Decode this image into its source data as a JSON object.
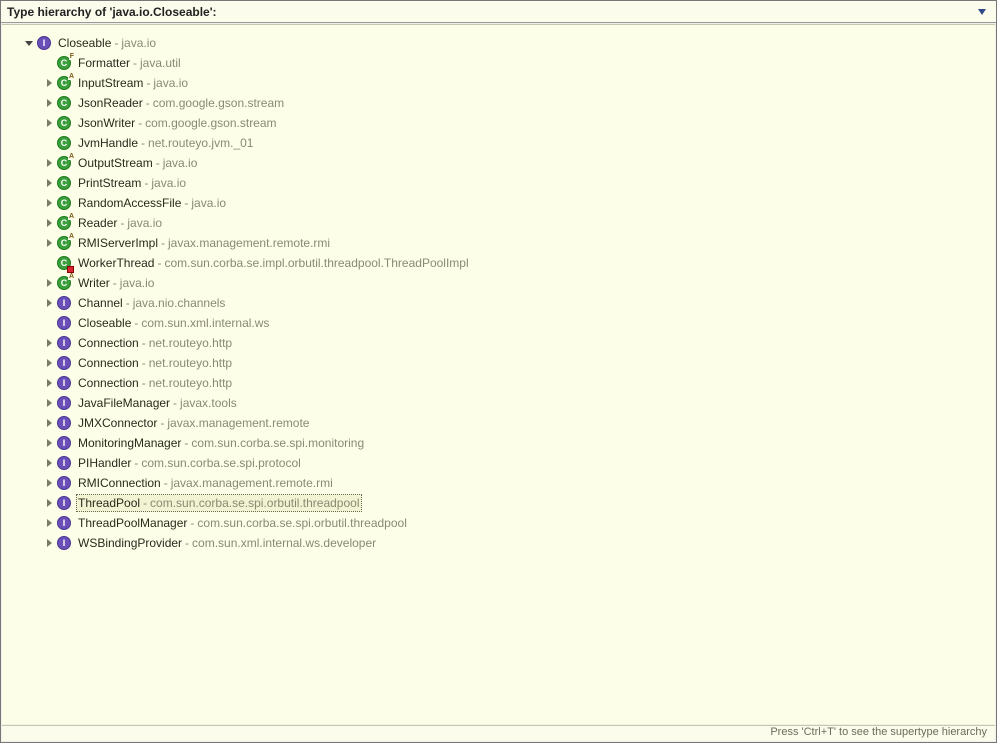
{
  "header": {
    "title": "Type hierarchy of 'java.io.Closeable':"
  },
  "footer": {
    "hint": "Press 'Ctrl+T' to see the supertype hierarchy"
  },
  "icon_letter": {
    "interface": "I",
    "class": "C"
  },
  "tree": {
    "root": {
      "name": "Closeable",
      "pkg": "java.io",
      "kind": "interface",
      "expanded": true,
      "children": [
        {
          "name": "Formatter",
          "pkg": "java.util",
          "kind": "class",
          "badge": "F",
          "hasChildren": false
        },
        {
          "name": "InputStream",
          "pkg": "java.io",
          "kind": "class",
          "badge": "A",
          "hasChildren": true
        },
        {
          "name": "JsonReader",
          "pkg": "com.google.gson.stream",
          "kind": "class",
          "hasChildren": true
        },
        {
          "name": "JsonWriter",
          "pkg": "com.google.gson.stream",
          "kind": "class",
          "hasChildren": true
        },
        {
          "name": "JvmHandle",
          "pkg": "net.routeyo.jvm._01",
          "kind": "class",
          "hasChildren": false
        },
        {
          "name": "OutputStream",
          "pkg": "java.io",
          "kind": "class",
          "badge": "A",
          "hasChildren": true
        },
        {
          "name": "PrintStream",
          "pkg": "java.io",
          "kind": "class",
          "hasChildren": true
        },
        {
          "name": "RandomAccessFile",
          "pkg": "java.io",
          "kind": "class",
          "hasChildren": true
        },
        {
          "name": "Reader",
          "pkg": "java.io",
          "kind": "class",
          "badge": "A",
          "hasChildren": true
        },
        {
          "name": "RMIServerImpl",
          "pkg": "javax.management.remote.rmi",
          "kind": "class",
          "badge": "A",
          "hasChildren": true
        },
        {
          "name": "WorkerThread",
          "pkg": "com.sun.corba.se.impl.orbutil.threadpool.ThreadPoolImpl",
          "kind": "class",
          "error": true,
          "hasChildren": false
        },
        {
          "name": "Writer",
          "pkg": "java.io",
          "kind": "class",
          "badge": "A",
          "hasChildren": true
        },
        {
          "name": "Channel",
          "pkg": "java.nio.channels",
          "kind": "interface",
          "hasChildren": true
        },
        {
          "name": "Closeable",
          "pkg": "com.sun.xml.internal.ws",
          "kind": "interface",
          "hasChildren": false
        },
        {
          "name": "Connection",
          "pkg": "net.routeyo.http",
          "kind": "interface",
          "hasChildren": true
        },
        {
          "name": "Connection",
          "pkg": "net.routeyo.http",
          "kind": "interface",
          "hasChildren": true
        },
        {
          "name": "Connection",
          "pkg": "net.routeyo.http",
          "kind": "interface",
          "hasChildren": true
        },
        {
          "name": "JavaFileManager",
          "pkg": "javax.tools",
          "kind": "interface",
          "hasChildren": true
        },
        {
          "name": "JMXConnector",
          "pkg": "javax.management.remote",
          "kind": "interface",
          "hasChildren": true
        },
        {
          "name": "MonitoringManager",
          "pkg": "com.sun.corba.se.spi.monitoring",
          "kind": "interface",
          "hasChildren": true
        },
        {
          "name": "PIHandler",
          "pkg": "com.sun.corba.se.spi.protocol",
          "kind": "interface",
          "hasChildren": true
        },
        {
          "name": "RMIConnection",
          "pkg": "javax.management.remote.rmi",
          "kind": "interface",
          "hasChildren": true
        },
        {
          "name": "ThreadPool",
          "pkg": "com.sun.corba.se.spi.orbutil.threadpool",
          "kind": "interface",
          "hasChildren": true,
          "selected": true
        },
        {
          "name": "ThreadPoolManager",
          "pkg": "com.sun.corba.se.spi.orbutil.threadpool",
          "kind": "interface",
          "hasChildren": true
        },
        {
          "name": "WSBindingProvider",
          "pkg": "com.sun.xml.internal.ws.developer",
          "kind": "interface",
          "hasChildren": true
        }
      ]
    }
  }
}
